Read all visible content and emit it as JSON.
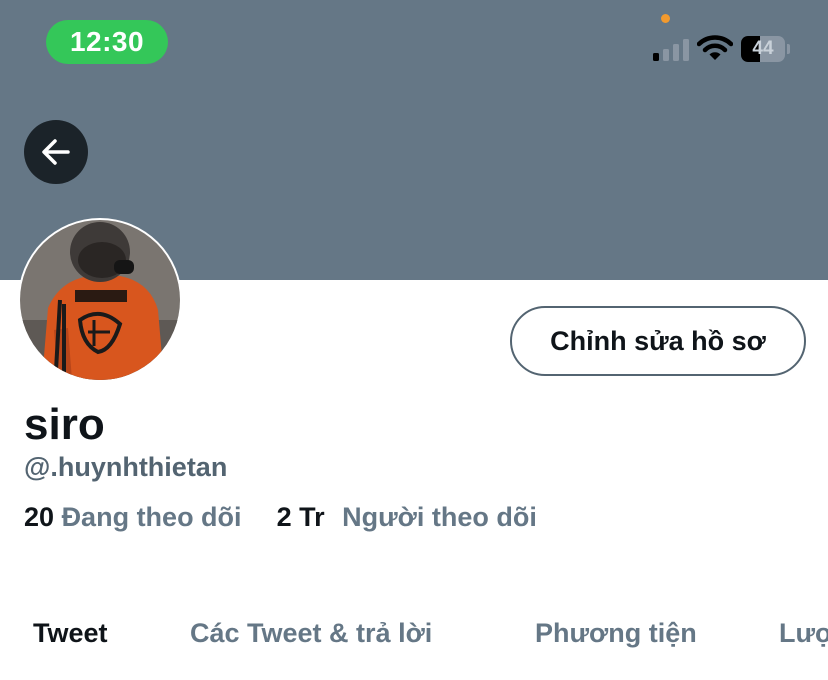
{
  "status_bar": {
    "time": "12:30",
    "battery_level": "44",
    "battery_fraction": 0.44,
    "signal_bars_active": 1,
    "signal_bars_total": 4
  },
  "colors": {
    "banner": "#657786",
    "accent_green": "#34c759",
    "text_primary": "#0f1419",
    "text_secondary": "#657786"
  },
  "header": {
    "back_icon": "arrow-left-icon"
  },
  "profile": {
    "edit_button_label": "Chỉnh sửa hồ sơ",
    "display_name": "siro",
    "handle": "@.huynhthietan",
    "following_count": "20",
    "following_label": "Đang theo dõi",
    "followers_count": "2 Tr",
    "followers_label": "Người theo dõi"
  },
  "tabs": [
    {
      "label": "Tweet",
      "active": true
    },
    {
      "label": "Các Tweet & trả lời",
      "active": false
    },
    {
      "label": "Phương tiện",
      "active": false
    },
    {
      "label": "Lượt thích",
      "active": false
    }
  ]
}
